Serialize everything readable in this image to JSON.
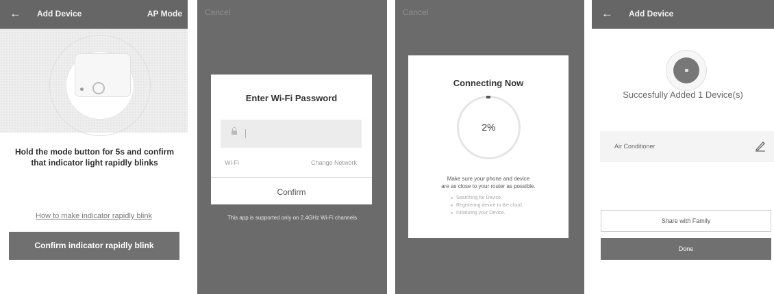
{
  "screen1": {
    "header": {
      "back_icon": "arrow-left-icon",
      "title": "Add Device",
      "right_action": "AP Mode"
    },
    "illustration": {
      "subject": "smart-plug",
      "icons": [
        "led-indicator-icon",
        "power-button-icon"
      ]
    },
    "instruction": "Hold the mode button for 5s and confirm that indicator light rapidly blinks",
    "help_link": "How to make indicator rapidly blink",
    "confirm_button": "Confirm indicator rapidly blink"
  },
  "screen2": {
    "cancel": "Cancel",
    "dialog": {
      "title": "Enter Wi-Fi Password",
      "password_field": {
        "icon": "lock-icon",
        "value": ""
      },
      "wifi_label": "Wi-Fi",
      "change_network": "Change Network",
      "confirm": "Confirm"
    },
    "note": "This app is supported only on 2.4GHz Wi-Fi channels"
  },
  "screen3": {
    "cancel": "Cancel",
    "dialog": {
      "title": "Connecting Now",
      "progress": {
        "value": 2,
        "display": "2%"
      },
      "message_line1": "Make sure your phone and device",
      "message_line2": "are as close to your router as possible.",
      "steps": [
        "Searching for Device.",
        "Registering device to the cloud.",
        "Initializing your Device."
      ]
    }
  },
  "screen4": {
    "header": {
      "back_icon": "arrow-left-icon",
      "title": "Add Device"
    },
    "success_text": "Succesfully Added 1 Device(s)",
    "device": {
      "name": "Air Conditioner",
      "edit_icon": "pencil-icon"
    },
    "share_button": "Share with Family",
    "done_button": "Done"
  },
  "colors": {
    "header_bar": "#666666",
    "overlay": "#6b6b6b",
    "primary_button": "#707070",
    "dialog_bg": "#ffffff"
  }
}
